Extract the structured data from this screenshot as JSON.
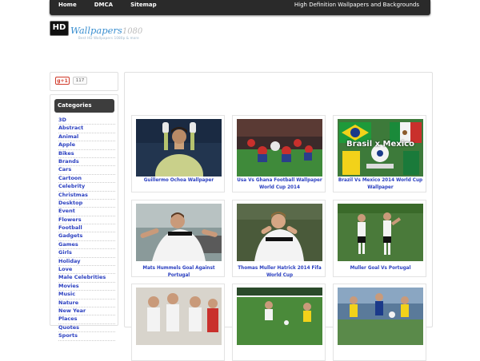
{
  "nav": {
    "items": [
      "Home",
      "DMCA",
      "Sitemap"
    ],
    "tagline": "High Definition Wallpapers and Backgrounds"
  },
  "logo": {
    "badge": "HD",
    "word": "Wallpapers",
    "suffix": "1080",
    "subtitle": "Best HD Wallpapers 1080p & more"
  },
  "social": {
    "gplus_label": "g+1",
    "gplus_count": "117"
  },
  "categories": {
    "title": "Categories",
    "items": [
      "3D",
      "Abstract",
      "Animal",
      "Apple",
      "Bikes",
      "Brands",
      "Cars",
      "Cartoon",
      "Celebrity",
      "Christmas",
      "Desktop",
      "Event",
      "Flowers",
      "Football",
      "Gadgets",
      "Games",
      "Girls",
      "Holiday",
      "Love",
      "Male Celebrities",
      "Movies",
      "Music",
      "Nature",
      "New Year",
      "Places",
      "Quotes",
      "Sports"
    ]
  },
  "wallpapers": [
    {
      "title": "Guillermo Ochoa Wallpaper"
    },
    {
      "title": "Usa Vs Ghana Football Wallpaper World Cup 2014"
    },
    {
      "title": "Brazil Vs Mexico 2014 World Cup Wallpaper",
      "banner": "Brasil x Mexico"
    },
    {
      "title": "Mats Hummels Goal Against Portugal"
    },
    {
      "title": "Thomas Muller Hatrick 2014 Fifa World Cup"
    },
    {
      "title": "Muller Goal Vs Portugal"
    },
    {
      "title": ""
    },
    {
      "title": ""
    },
    {
      "title": ""
    }
  ]
}
